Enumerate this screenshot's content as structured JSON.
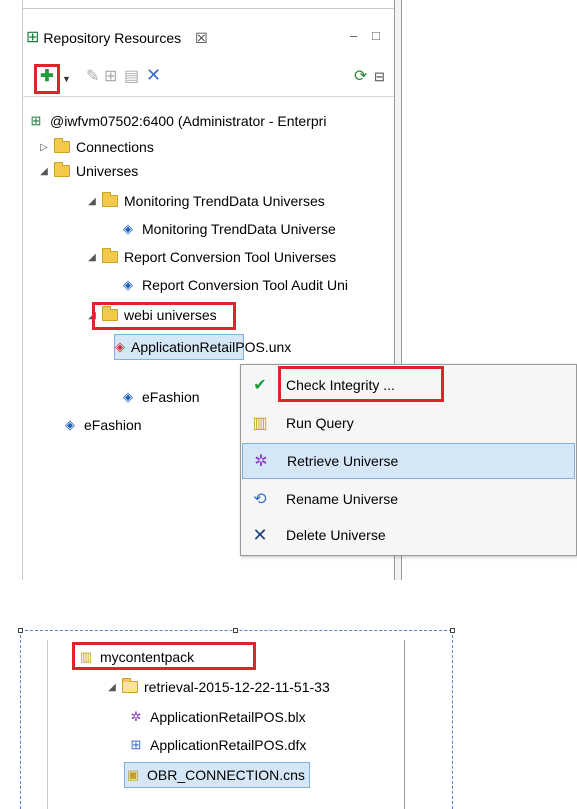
{
  "tab": {
    "title": "Repository Resources",
    "close": "☒",
    "minimize": "–",
    "maximize": "□"
  },
  "toolbar": {
    "insert_icon": "plus-icon",
    "edit_icon": "pencil-icon",
    "delete_icon": "x-icon",
    "refresh_icon": "refresh-icon",
    "collapse_icon": "collapse-icon"
  },
  "tree": {
    "root": "@iwfvm07502:6400 (Administrator - Enterpri",
    "connections": "Connections",
    "universes": "Universes",
    "monitoring_folder": "Monitoring TrendData Universes",
    "monitoring_universe": "Monitoring TrendData Universe",
    "report_folder": "Report Conversion Tool Universes",
    "report_universe": "Report Conversion Tool Audit Uni",
    "webi_folder": "webi universes",
    "app_universe": "ApplicationRetailPOS.unx",
    "efashion_child": "eFashion",
    "efashion_root": "eFashion"
  },
  "context_menu": {
    "items": [
      {
        "label": "Check Integrity ...",
        "icon": "check-integrity-icon"
      },
      {
        "label": "Run Query",
        "icon": "run-query-icon"
      },
      {
        "label": "Retrieve Universe",
        "icon": "retrieve-universe-icon"
      },
      {
        "label": "Rename Universe",
        "icon": "rename-icon"
      },
      {
        "label": "Delete Universe",
        "icon": "delete-icon"
      }
    ]
  },
  "project": {
    "name": "mycontentpack",
    "retrieval_folder": "retrieval-2015-12-22-11-51-33",
    "files": [
      "ApplicationRetailPOS.blx",
      "ApplicationRetailPOS.dfx",
      "OBR_CONNECTION.cns"
    ]
  },
  "colors": {
    "highlight_box": "#e0242b",
    "selection": "#d5e7f7",
    "folder": "#f2c94c"
  }
}
